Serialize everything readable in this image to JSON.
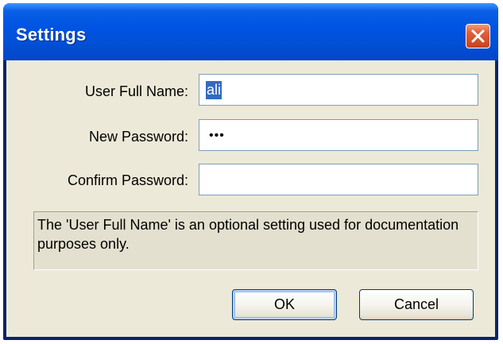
{
  "window": {
    "title": "Settings"
  },
  "icons": {
    "close": "close-icon"
  },
  "form": {
    "user_full_name_label": "User Full Name:",
    "user_full_name_value": "ali",
    "new_password_label": "New Password:",
    "new_password_value": "•••",
    "confirm_password_label": "Confirm Password:",
    "confirm_password_value": ""
  },
  "info": {
    "text": "The 'User Full Name' is an optional setting used for documentation purposes only."
  },
  "buttons": {
    "ok_label": "OK",
    "cancel_label": "Cancel"
  },
  "colors": {
    "titlebar": "#0054e3",
    "dialog_face": "#ece9d8",
    "selection": "#316ac5",
    "close_button": "#e0603a"
  }
}
